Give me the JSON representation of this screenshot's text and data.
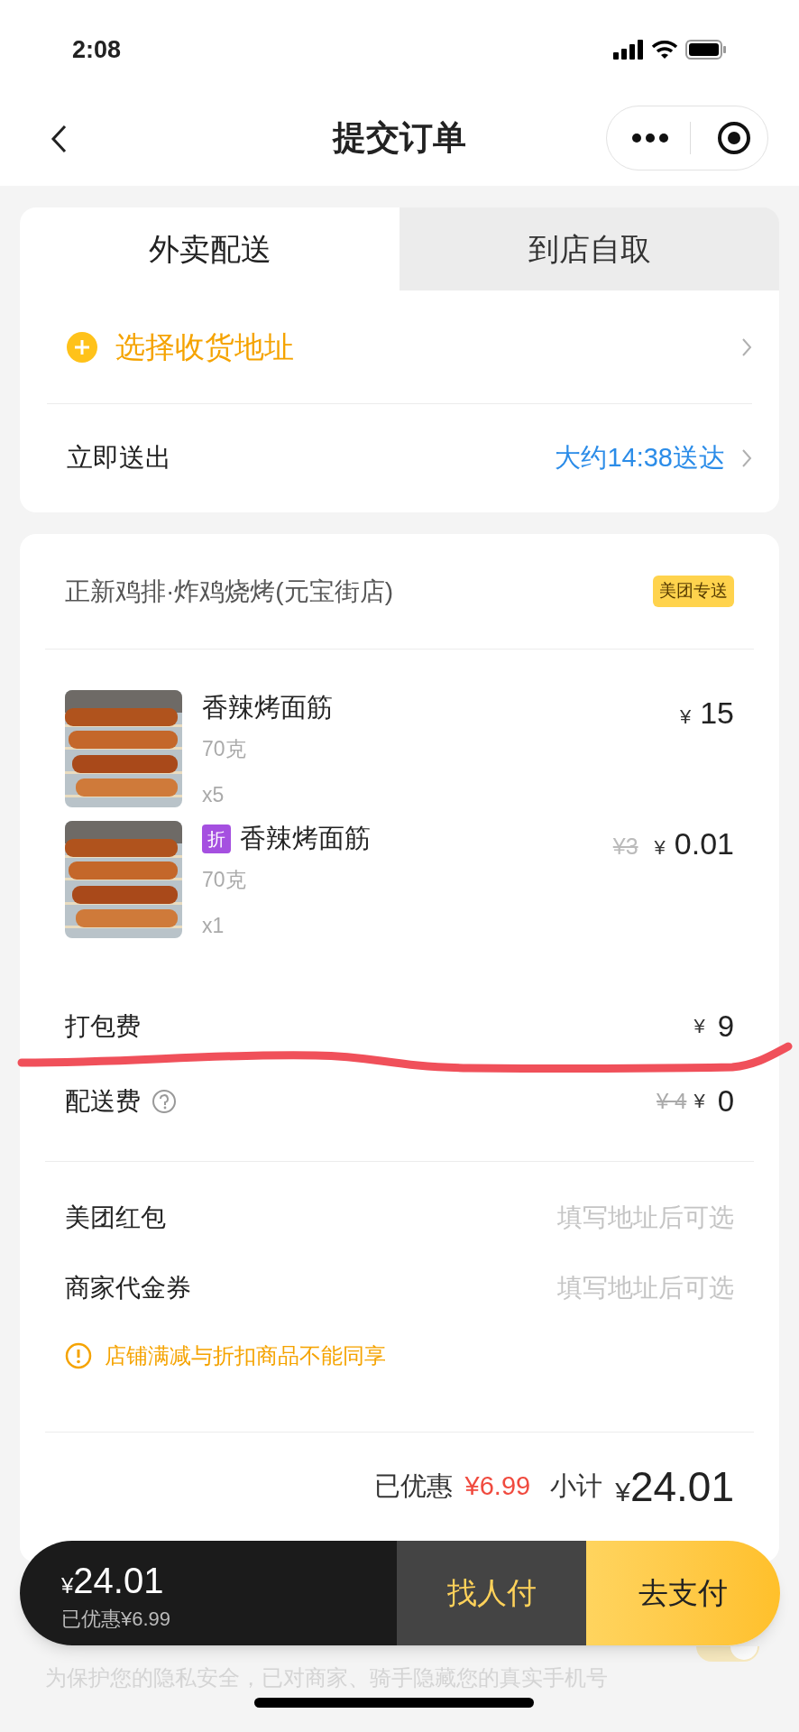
{
  "status_bar": {
    "time": "2:08"
  },
  "nav": {
    "title": "提交订单"
  },
  "delivery_tabs": [
    {
      "label": "外卖配送",
      "selected": true
    },
    {
      "label": "到店自取",
      "selected": false
    }
  ],
  "address": {
    "label": "选择收货地址"
  },
  "delivery_time": {
    "label": "立即送出",
    "value": "大约14:38送达"
  },
  "store": {
    "name": "正新鸡排·炸鸡烧烤(元宝街店)",
    "badge": "美团专送"
  },
  "items": [
    {
      "name": "香辣烤面筋",
      "spec": "70克",
      "quantity": "x5",
      "currency": "¥",
      "amount": "15"
    },
    {
      "name": "香辣烤面筋",
      "tag": "折",
      "spec": "70克",
      "quantity": "x1",
      "original_price": "¥3",
      "currency": "¥",
      "amount": "0.01"
    }
  ],
  "fees": [
    {
      "label": "打包费",
      "currency": "¥",
      "amount": "9"
    },
    {
      "label": "配送费",
      "help": true,
      "original_price": "¥ 4",
      "currency": "¥",
      "amount": "0"
    }
  ],
  "discounts": [
    {
      "label": "美团红包",
      "value": "填写地址后可选"
    },
    {
      "label": "商家代金券",
      "value": "填写地址后可选"
    }
  ],
  "notice": "店铺满减与折扣商品不能同享",
  "summary": {
    "saved_label": "已优惠",
    "saved": "¥6.99",
    "subtotal_label": "小计",
    "currency": "¥",
    "subtotal": "24.01"
  },
  "pay_bar": {
    "currency": "¥",
    "total": "24.01",
    "saved": "已优惠¥6.99",
    "buttons": [
      {
        "label": "找人付",
        "kind": "secondary"
      },
      {
        "label": "去支付",
        "kind": "primary"
      }
    ]
  },
  "privacy_toggle": {
    "on": true
  },
  "privacy_note": "为保护您的隐私安全，已对商家、骑手隐藏您的真实手机号"
}
